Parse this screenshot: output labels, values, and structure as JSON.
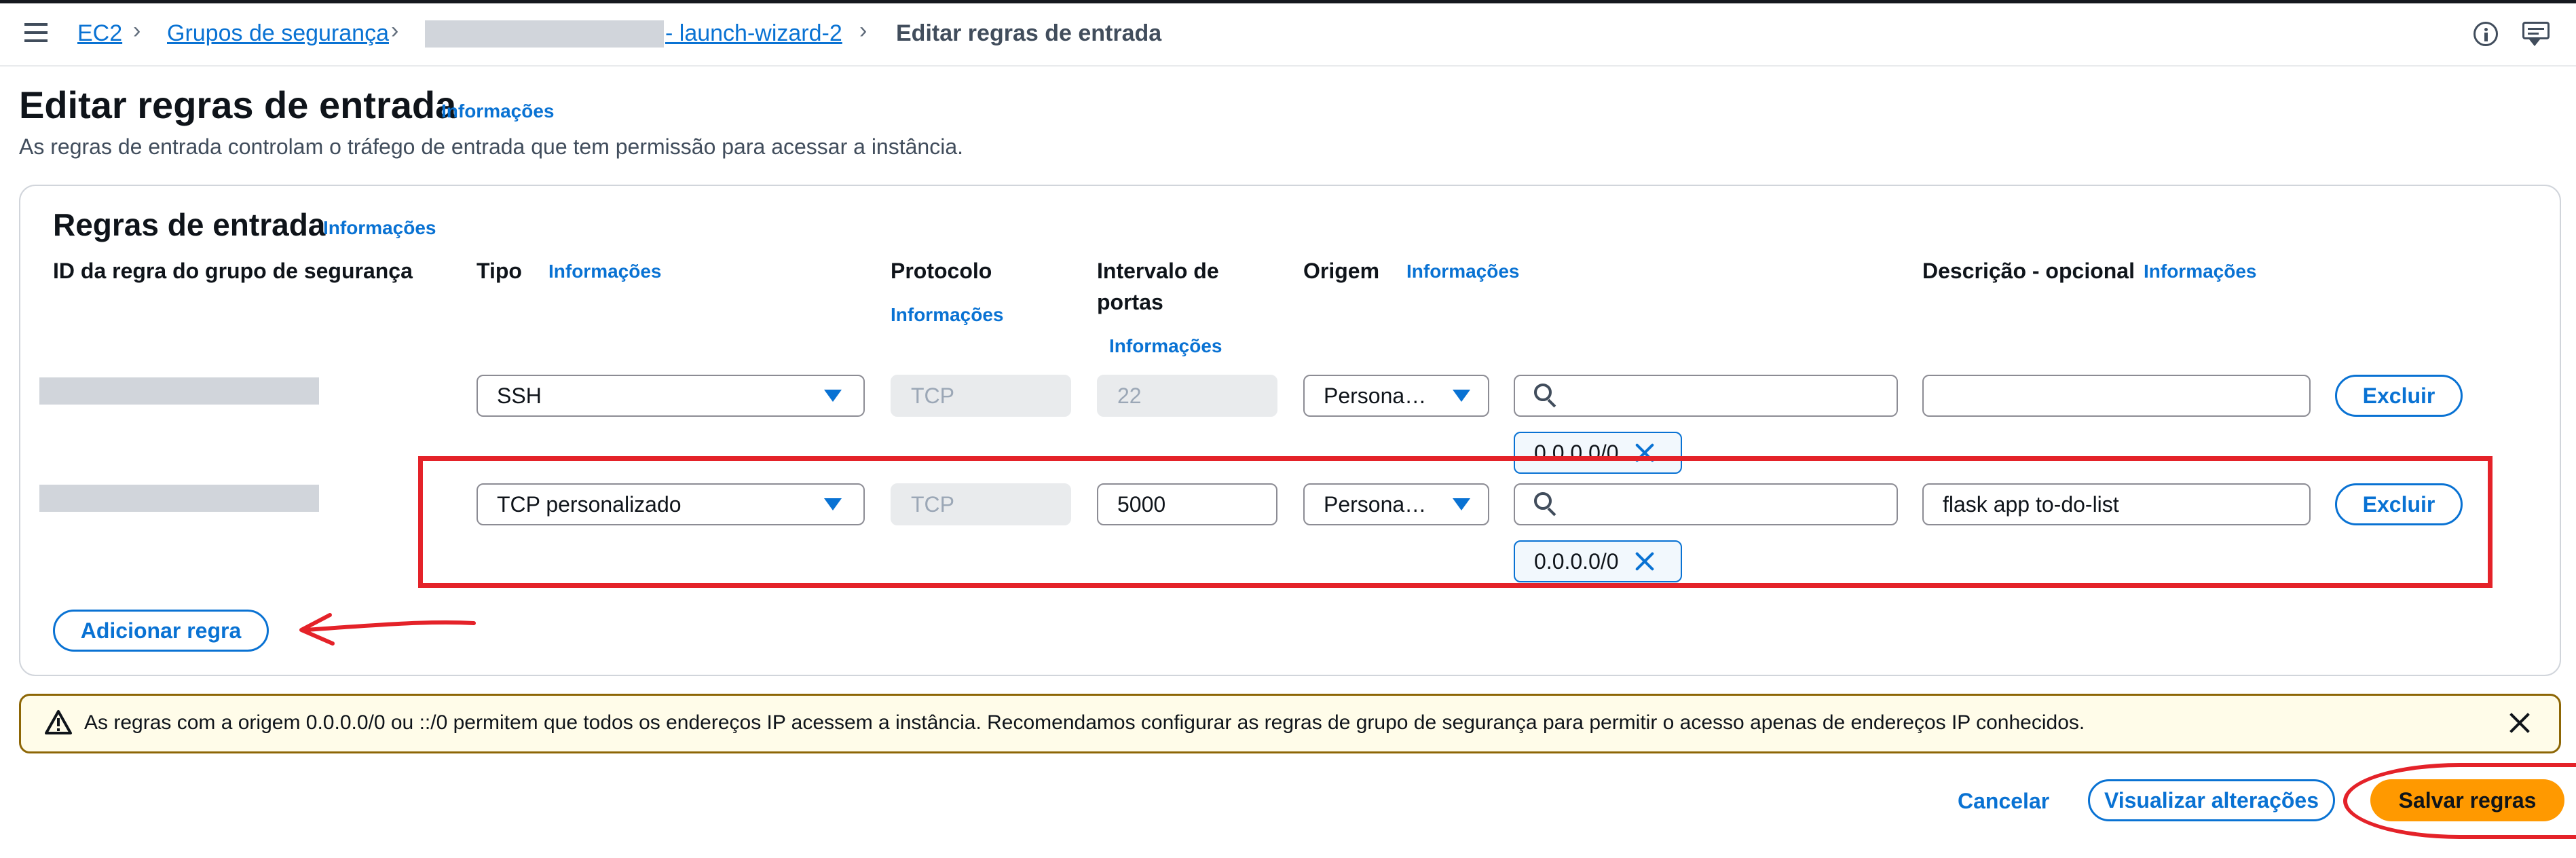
{
  "breadcrumb": {
    "ec2": "EC2",
    "security_groups": "Grupos de segurança",
    "sg_name": "- launch-wizard-2",
    "current": "Editar regras de entrada"
  },
  "page": {
    "title": "Editar regras de entrada",
    "info": "Informações",
    "subtitle": "As regras de entrada controlam o tráfego de entrada que tem permissão para acessar a instância."
  },
  "panel": {
    "title": "Regras de entrada",
    "info": "Informações",
    "columns": {
      "rule_id": "ID da regra do grupo de segurança",
      "type": "Tipo",
      "protocol": "Protocolo",
      "port_range_line1": "Intervalo de",
      "port_range_line2": "portas",
      "source": "Origem",
      "description": "Descrição - opcional",
      "info": "Informações"
    },
    "rules": [
      {
        "type": "SSH",
        "protocol": "TCP",
        "port": "22",
        "source_mode": "Persona…",
        "cidr": "0.0.0.0/0",
        "description": "",
        "delete": "Excluir"
      },
      {
        "type": "TCP personalizado",
        "protocol": "TCP",
        "port": "5000",
        "source_mode": "Persona…",
        "cidr": "0.0.0.0/0",
        "description": "flask app to-do-list",
        "delete": "Excluir"
      }
    ],
    "add_rule": "Adicionar regra"
  },
  "alert": {
    "text": "As regras com a origem 0.0.0.0/0 ou ::/0 permitem que todos os endereços IP acessem a instância. Recomendamos configurar as regras de grupo de segurança para permitir o acesso apenas de endereços IP conhecidos."
  },
  "footer": {
    "cancel": "Cancelar",
    "preview": "Visualizar alterações",
    "save": "Salvar regras"
  },
  "icons": {
    "menu": "menu-icon",
    "info": "info-circle-icon",
    "feedback": "feedback-icon",
    "warning": "warning-triangle-icon",
    "close": "close-icon"
  },
  "colors": {
    "link": "#0972d3",
    "primary": "#ff9900",
    "annotation": "#e42229",
    "warning_border": "#8d6605"
  }
}
